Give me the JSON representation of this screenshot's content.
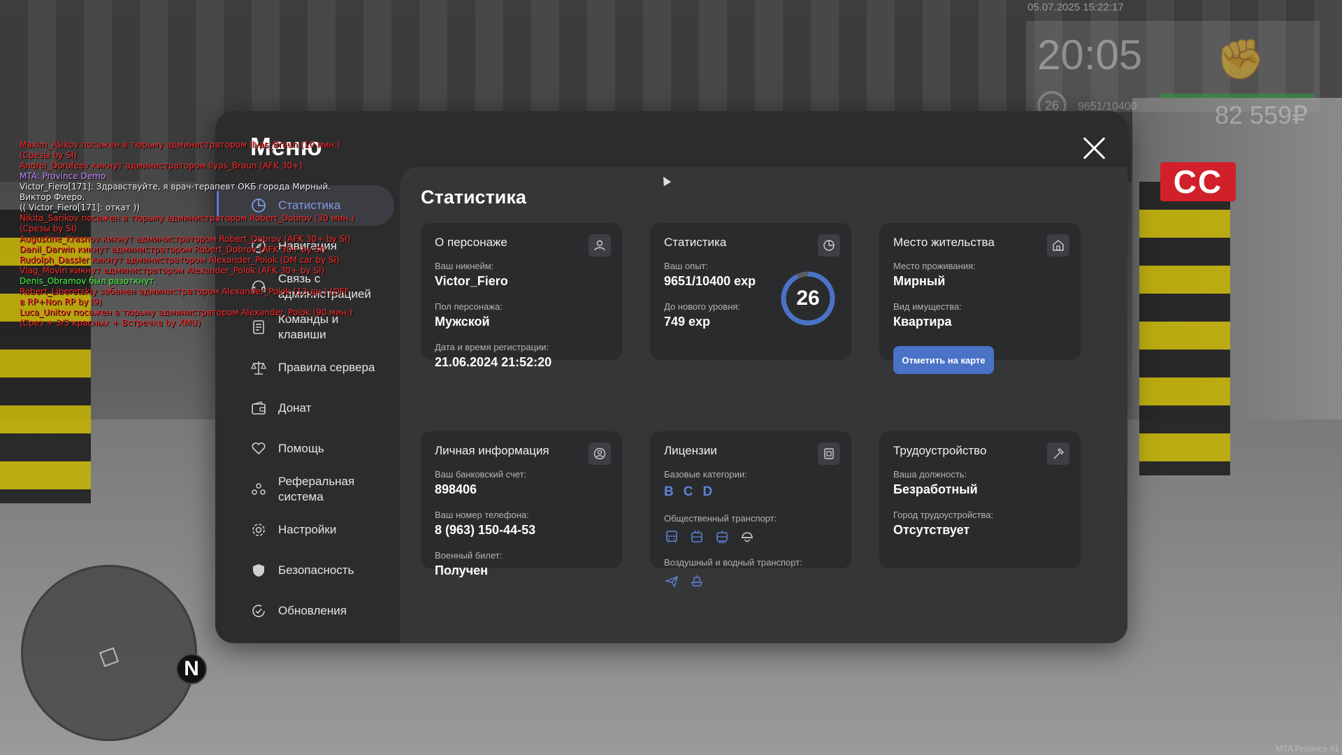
{
  "hud": {
    "datetime": "05.07.2025 15:22:17",
    "time": "20:05",
    "level": "26",
    "exp": "9651/10400",
    "money": "82 559₽",
    "sign_text": "CC"
  },
  "chat": [
    {
      "color": "red",
      "text": "Maxim_Asikov посажен в тюрьму администратором Ilyas_Braun (10 мин.) (Срезы by SI)"
    },
    {
      "color": "red",
      "text": "Andrei_Dorofeev кикнут администратором Ilyas_Braun (AFK 30+)"
    },
    {
      "color": "purple",
      "text": "MTA: Province Demo"
    },
    {
      "color": "white",
      "text": "Victor_Fiero[171]: Здравствуйте, я врач-терапевт ОКБ города Мирный. Виктор Фиеро."
    },
    {
      "color": "white",
      "text": "(( Victor_Fiero[171]: откат ))"
    },
    {
      "color": "red",
      "text": "Nikita_Sarikov посажен в тюрьму администратором Robert_Dobrov (30 мин.) (Срезы by SI)"
    },
    {
      "color": "red",
      "text": "Augustine_Krasnov кикнут администратором Robert_Dobrov (AFK 30+ by SI)"
    },
    {
      "color": "red",
      "text": "Danil_Darwin кикнут администратором Robert_Dobrov (AFK 30+ by SI)"
    },
    {
      "color": "red",
      "text": "Rudolph_Dassler кикнут администратором Alexander_Polok (DM car by SI)"
    },
    {
      "color": "red",
      "text": "Vlag_Movin кикнут администратором Alexander_Polok (AFK 30+ by SI)"
    },
    {
      "color": "green",
      "text": "Denis_Obramov был разоткнут."
    },
    {
      "color": "red",
      "text": "Robert_Liberetskiy забанен администратором Alexander_Polok (13 дн.) (OFF в RP+Non RP by I9)"
    },
    {
      "color": "red",
      "text": "Luca_Unitov посажен в тюрьму администратором Alexander_Polok (90 мин.) (Срез + 3/3 красных + Встречка by XMU)"
    }
  ],
  "menu": {
    "title": "Меню",
    "nav": [
      {
        "label": "Статистика",
        "icon": "pie-chart-icon",
        "active": true
      },
      {
        "label": "Навигация",
        "icon": "compass-icon"
      },
      {
        "label": "Связь с администрацией",
        "icon": "headset-icon"
      },
      {
        "label": "Команды и клавиши",
        "icon": "document-icon"
      },
      {
        "label": "Правила сервера",
        "icon": "scales-icon"
      },
      {
        "label": "Донат",
        "icon": "wallet-icon"
      },
      {
        "label": "Помощь",
        "icon": "heart-hand-icon"
      },
      {
        "label": "Реферальная система",
        "icon": "people-icon"
      },
      {
        "label": "Настройки",
        "icon": "gear-icon"
      },
      {
        "label": "Безопасность",
        "icon": "shield-icon"
      },
      {
        "label": "Обновления",
        "icon": "refresh-check-icon"
      }
    ]
  },
  "stats": {
    "title": "Статистика",
    "character": {
      "title": "О персонаже",
      "nickname_label": "Ваш никнейм:",
      "nickname": "Victor_Fiero",
      "gender_label": "Пол персонажа:",
      "gender": "Мужской",
      "reg_label": "Дата и время регистрации:",
      "reg_date": "21.06.2024 21:52:20"
    },
    "statistics": {
      "title": "Статистика",
      "exp_label": "Ваш опыт:",
      "exp": "9651/10400 exp",
      "next_label": "До нового уровня:",
      "next": "749 exp",
      "level": "26",
      "progress": 0.928
    },
    "residence": {
      "title": "Место жительства",
      "place_label": "Место проживания:",
      "place": "Мирный",
      "property_label": "Вид имущества:",
      "property": "Квартира",
      "map_button": "Отметить на карте"
    },
    "personal": {
      "title": "Личная информация",
      "bank_label": "Ваш банковский счет:",
      "bank": "898406",
      "phone_label": "Ваш номер телефона:",
      "phone": "8 (963) 150-44-53",
      "military_label": "Военный билет:",
      "military": "Получен"
    },
    "licenses": {
      "title": "Лицензии",
      "base_label": "Базовые категории:",
      "categories": [
        "B",
        "C",
        "D"
      ],
      "public_label": "Общественный транспорт:",
      "public_icons": [
        "bus-icon",
        "trolleybus-icon",
        "tram-icon",
        "helmet-icon"
      ],
      "air_label": "Воздушный и водный транспорт:",
      "air_icons": [
        "plane-icon",
        "boat-icon"
      ]
    },
    "employment": {
      "title": "Трудоустройство",
      "position_label": "Ваша должность:",
      "position": "Безработный",
      "city_label": "Город трудоустройства:",
      "city": "Отсутствует"
    }
  },
  "watermark": "MTA Province #1",
  "colors": {
    "accent": "#5b7bd9",
    "button": "#4a72c6",
    "category": "#5f84d6"
  }
}
